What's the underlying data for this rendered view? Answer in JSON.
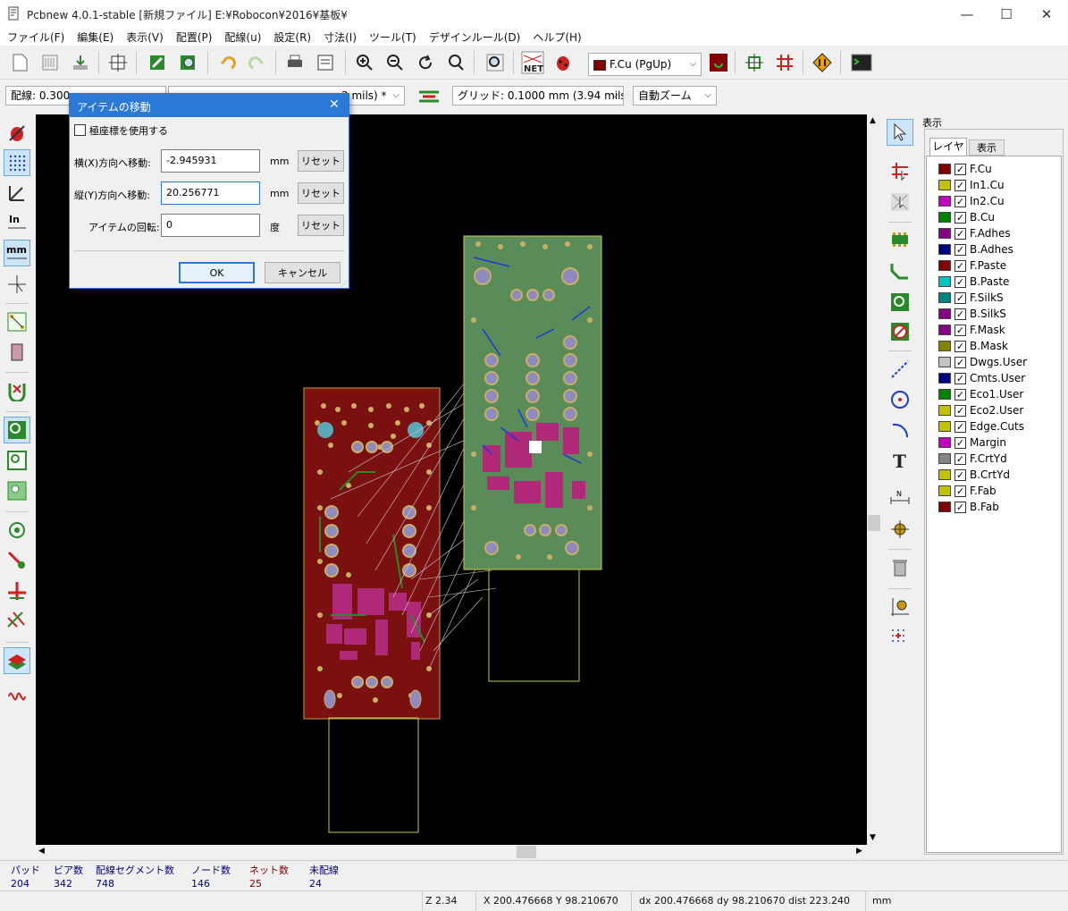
{
  "window": {
    "title": "Pcbnew 4.0.1-stable  [新規ファイル] E:¥Robocon¥2016¥基板¥",
    "minimize": "—",
    "maximize": "☐",
    "close": "✕"
  },
  "menu": [
    "ファイル(F)",
    "編集(E)",
    "表示(V)",
    "配置(P)",
    "配線(u)",
    "設定(R)",
    "寸法(I)",
    "ツール(T)",
    "デザインルール(D)",
    "ヘルプ(H)"
  ],
  "toolbar": {
    "layer_select": "F.Cu (PgUp)",
    "net_label": "NET"
  },
  "toolbar2": {
    "track_width": "配線: 0.300 m",
    "via_size": "3 mils) *",
    "grid": "グリッド: 0.1000 mm (3.94 mils)",
    "zoom": "自動ズーム"
  },
  "dialog": {
    "title": "アイテムの移動",
    "close": "✕",
    "polar_label": "極座標を使用する",
    "polar_checked": false,
    "x_label": "横(X)方向へ移動:",
    "x_value": "-2.945931",
    "x_unit": "mm",
    "y_label": "縦(Y)方向へ移動:",
    "y_value": "20.256771",
    "y_unit": "mm",
    "rot_label": "アイテムの回転:",
    "rot_value": "0",
    "rot_unit": "度",
    "reset": "リセット",
    "ok": "OK",
    "cancel": "キャンセル"
  },
  "panel": {
    "title": "表示",
    "tab_layers": "レイヤ",
    "tab_render": "表示",
    "layers": [
      {
        "name": "F.Cu",
        "color": "#840000"
      },
      {
        "name": "In1.Cu",
        "color": "#c2c200"
      },
      {
        "name": "In2.Cu",
        "color": "#c200c2"
      },
      {
        "name": "B.Cu",
        "color": "#008400"
      },
      {
        "name": "F.Adhes",
        "color": "#840084"
      },
      {
        "name": "B.Adhes",
        "color": "#000084"
      },
      {
        "name": "F.Paste",
        "color": "#840000"
      },
      {
        "name": "B.Paste",
        "color": "#00c2c2"
      },
      {
        "name": "F.SilkS",
        "color": "#008484"
      },
      {
        "name": "B.SilkS",
        "color": "#840084"
      },
      {
        "name": "F.Mask",
        "color": "#840084"
      },
      {
        "name": "B.Mask",
        "color": "#848400"
      },
      {
        "name": "Dwgs.User",
        "color": "#c2c2c2"
      },
      {
        "name": "Cmts.User",
        "color": "#000084"
      },
      {
        "name": "Eco1.User",
        "color": "#008400"
      },
      {
        "name": "Eco2.User",
        "color": "#c2c200"
      },
      {
        "name": "Edge.Cuts",
        "color": "#c2c200"
      },
      {
        "name": "Margin",
        "color": "#c200c2"
      },
      {
        "name": "F.CrtYd",
        "color": "#848484"
      },
      {
        "name": "B.CrtYd",
        "color": "#c2c200"
      },
      {
        "name": "F.Fab",
        "color": "#c2c200"
      },
      {
        "name": "B.Fab",
        "color": "#840000"
      }
    ]
  },
  "stats": [
    {
      "label": "パッド",
      "value": "204",
      "color": "#000080"
    },
    {
      "label": "ビア数",
      "value": "342",
      "color": "#000080"
    },
    {
      "label": "配線セグメント数",
      "value": "748",
      "color": "#000080"
    },
    {
      "label": "ノード数",
      "value": "146",
      "color": "#000080"
    },
    {
      "label": "ネット数",
      "value": "25",
      "color": "#800000"
    },
    {
      "label": "未配線",
      "value": "24",
      "color": "#000080"
    }
  ],
  "status": {
    "zoom": "Z 2.34",
    "coords": "X 200.476668  Y 98.210670",
    "delta": "dx 200.476668  dy 98.210670  dist 223.240",
    "units": "mm"
  }
}
